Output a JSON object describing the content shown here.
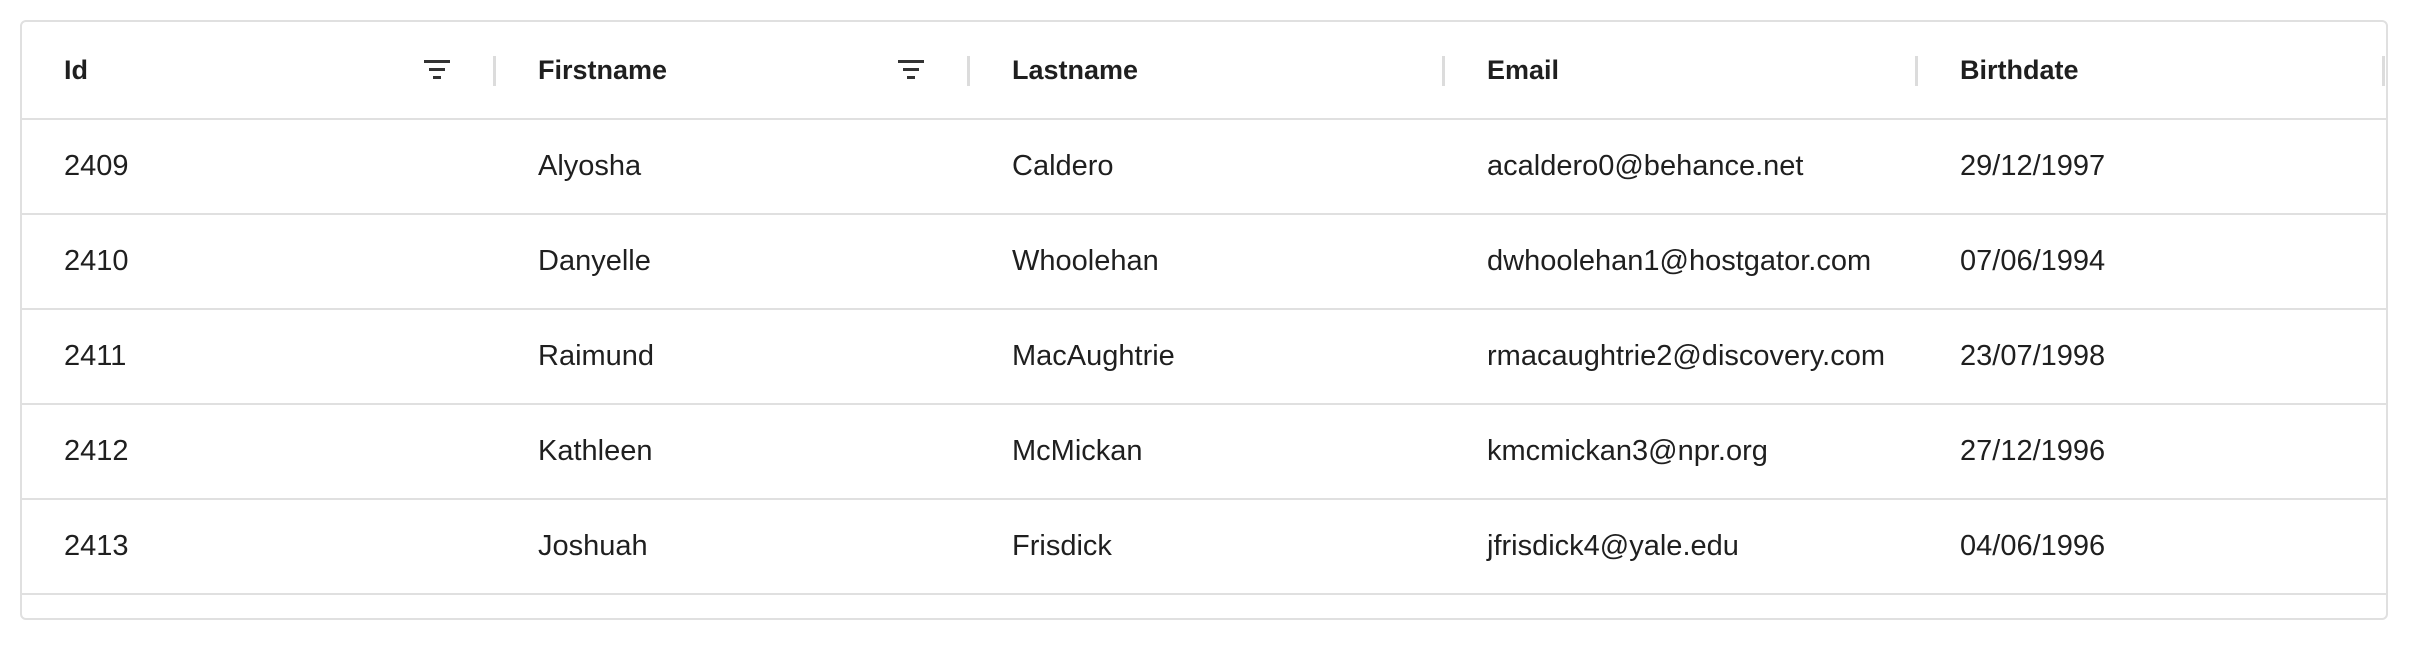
{
  "columns": [
    {
      "label": "Id",
      "filter_icon": "filter-icon"
    },
    {
      "label": "Firstname",
      "filter_icon": "filter-icon"
    },
    {
      "label": "Lastname"
    },
    {
      "label": "Email"
    },
    {
      "label": "Birthdate"
    }
  ],
  "rows": [
    {
      "id": "2409",
      "firstname": "Alyosha",
      "lastname": "Caldero",
      "email": "acaldero0@behance.net",
      "birthdate": "29/12/1997"
    },
    {
      "id": "2410",
      "firstname": "Danyelle",
      "lastname": "Whoolehan",
      "email": "dwhoolehan1@hostgator.com",
      "birthdate": "07/06/1994"
    },
    {
      "id": "2411",
      "firstname": "Raimund",
      "lastname": "MacAughtrie",
      "email": "rmacaughtrie2@discovery.com",
      "birthdate": "23/07/1998"
    },
    {
      "id": "2412",
      "firstname": "Kathleen",
      "lastname": "McMickan",
      "email": "kmcmickan3@npr.org",
      "birthdate": "27/12/1996"
    },
    {
      "id": "2413",
      "firstname": "Joshuah",
      "lastname": "Frisdick",
      "email": "jfrisdick4@yale.edu",
      "birthdate": "04/06/1996"
    }
  ]
}
